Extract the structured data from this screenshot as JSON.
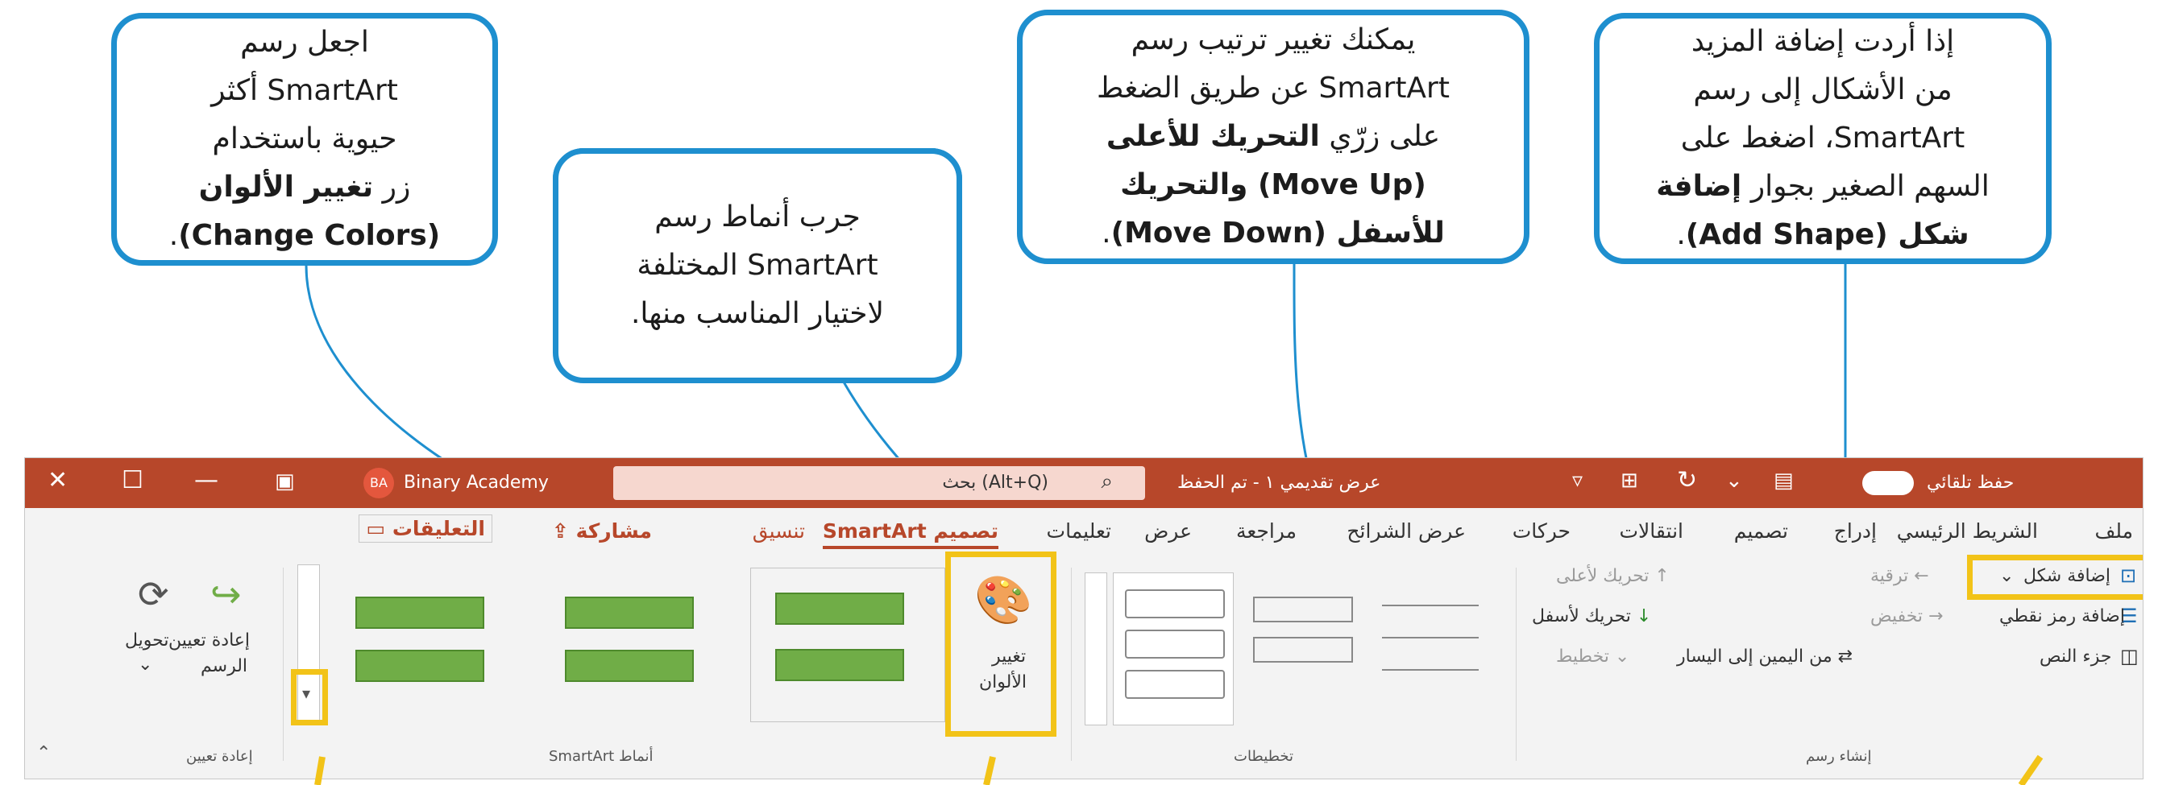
{
  "callouts": [
    {
      "lines": [
        {
          "t": "إذا أردت إضافة المزيد"
        },
        {
          "t": "من الأشكال إلى رسم"
        },
        {
          "t": "SmartArt، اضغط على"
        },
        {
          "t": "السهم الصغير بجوار ",
          "b": "إضافة"
        },
        {
          "b": "شكل (Add Shape)",
          "t": "."
        }
      ]
    },
    {
      "lines": [
        {
          "t": "يمكنك تغيير ترتيب رسم"
        },
        {
          "t": "SmartArt عن طريق الضغط"
        },
        {
          "t": "على زرّي ",
          "b": "التحريك للأعلى"
        },
        {
          "b": "(Move Up) والتحريك"
        },
        {
          "b": "للأسفل (Move Down)",
          "t": "."
        }
      ]
    },
    {
      "lines": [
        {
          "t": "جرب أنماط رسم"
        },
        {
          "t": "SmartArt المختلفة"
        },
        {
          "t": "لاختيار المناسب منها."
        }
      ]
    },
    {
      "lines": [
        {
          "t": "اجعل رسم"
        },
        {
          "t": "SmartArt أكثر"
        },
        {
          "t": "حيوية باستخدام"
        },
        {
          "t": "زر ",
          "b": "تغيير الألوان"
        },
        {
          "b": "(Change Colors)",
          "t": "."
        }
      ]
    }
  ],
  "titlebar": {
    "autosave": "حفظ تلقائي",
    "doc_title": "عرض تقديمي ١ - تم الحفظ",
    "search": "بحث (Alt+Q)",
    "user_initials": "BA",
    "user_name": "Binary Academy"
  },
  "tabs": [
    "ملف",
    "الشريط الرئيسي",
    "إدراج",
    "تصميم",
    "انتقالات",
    "حركات",
    "عرض الشرائح",
    "مراجعة",
    "عرض",
    "تعليمات",
    "تصميم SmartArt",
    "تنسيق"
  ],
  "share": "مشاركة",
  "comments": "التعليقات",
  "ribbon": {
    "add_shape": "إضافة شكل",
    "add_bullet": "إضافة رمز نقطي",
    "text_pane": "جزء النص",
    "promote": "ترقية",
    "demote": "تخفيض",
    "rtl": "من اليمين إلى اليسار",
    "layout": "تخطيط",
    "move_up": "تحريك لأعلى",
    "move_down": "تحريك لأسفل",
    "create_graphic": "إنشاء رسم",
    "layouts": "تخطيطات",
    "change_colors_1": "تغيير",
    "change_colors_2": "الألوان",
    "styles": "أنماط SmartArt",
    "reset_graphic_1": "إعادة تعيين",
    "reset_graphic_2": "الرسم",
    "convert": "تحويل",
    "reset": "إعادة تعيين"
  },
  "colors": {
    "accent": "#1e8fcf",
    "highlight": "#f2c318",
    "titlebar": "#b7472a"
  }
}
